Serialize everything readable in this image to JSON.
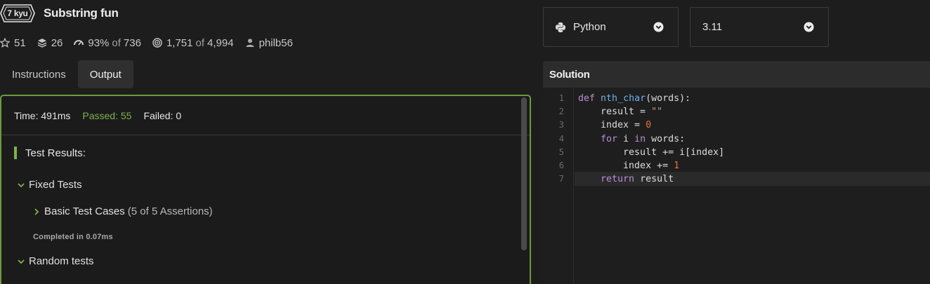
{
  "kata": {
    "rank": "7 kyu",
    "title": "Substring fun"
  },
  "stats": {
    "stars": "51",
    "collections": "26",
    "satisfaction": "93%",
    "satisfaction_of": "of",
    "satisfaction_votes": "736",
    "completed": "1,751",
    "completed_of": "of",
    "completed_attempts": "4,994",
    "author": "philb56"
  },
  "tabs": [
    {
      "label": "Instructions",
      "active": false
    },
    {
      "label": "Output",
      "active": true
    }
  ],
  "output": {
    "time": "Time: 491ms",
    "passed": "Passed: 55",
    "failed": "Failed: 0",
    "results_title": "Test Results:",
    "groups": [
      {
        "label": "Fixed Tests"
      },
      {
        "label": "Basic Test Cases",
        "assertions": "(5 of 5 Assertions)"
      },
      {
        "label": "Random tests"
      }
    ],
    "completed_in": "Completed in 0.07ms"
  },
  "language_select": {
    "value": "Python"
  },
  "version_select": {
    "value": "3.11"
  },
  "solution": {
    "title": "Solution",
    "line_numbers": [
      "1",
      "2",
      "3",
      "4",
      "5",
      "6",
      "7"
    ],
    "code": [
      "def nth_char(words):",
      "    result = \"\"",
      "    index = 0",
      "    for i in words:",
      "        result += i[index]",
      "        index += 1",
      "    return result"
    ]
  },
  "colors": {
    "accent_green": "#7fb14c",
    "panel_border": "#6a9c3b",
    "background": "#1d1d1d"
  },
  "icons": [
    "star-icon",
    "layers-icon",
    "satisfaction-icon",
    "target-icon",
    "user-icon",
    "python-icon",
    "chevron-circle-down-icon",
    "chevron-down-icon",
    "chevron-right-icon"
  ]
}
